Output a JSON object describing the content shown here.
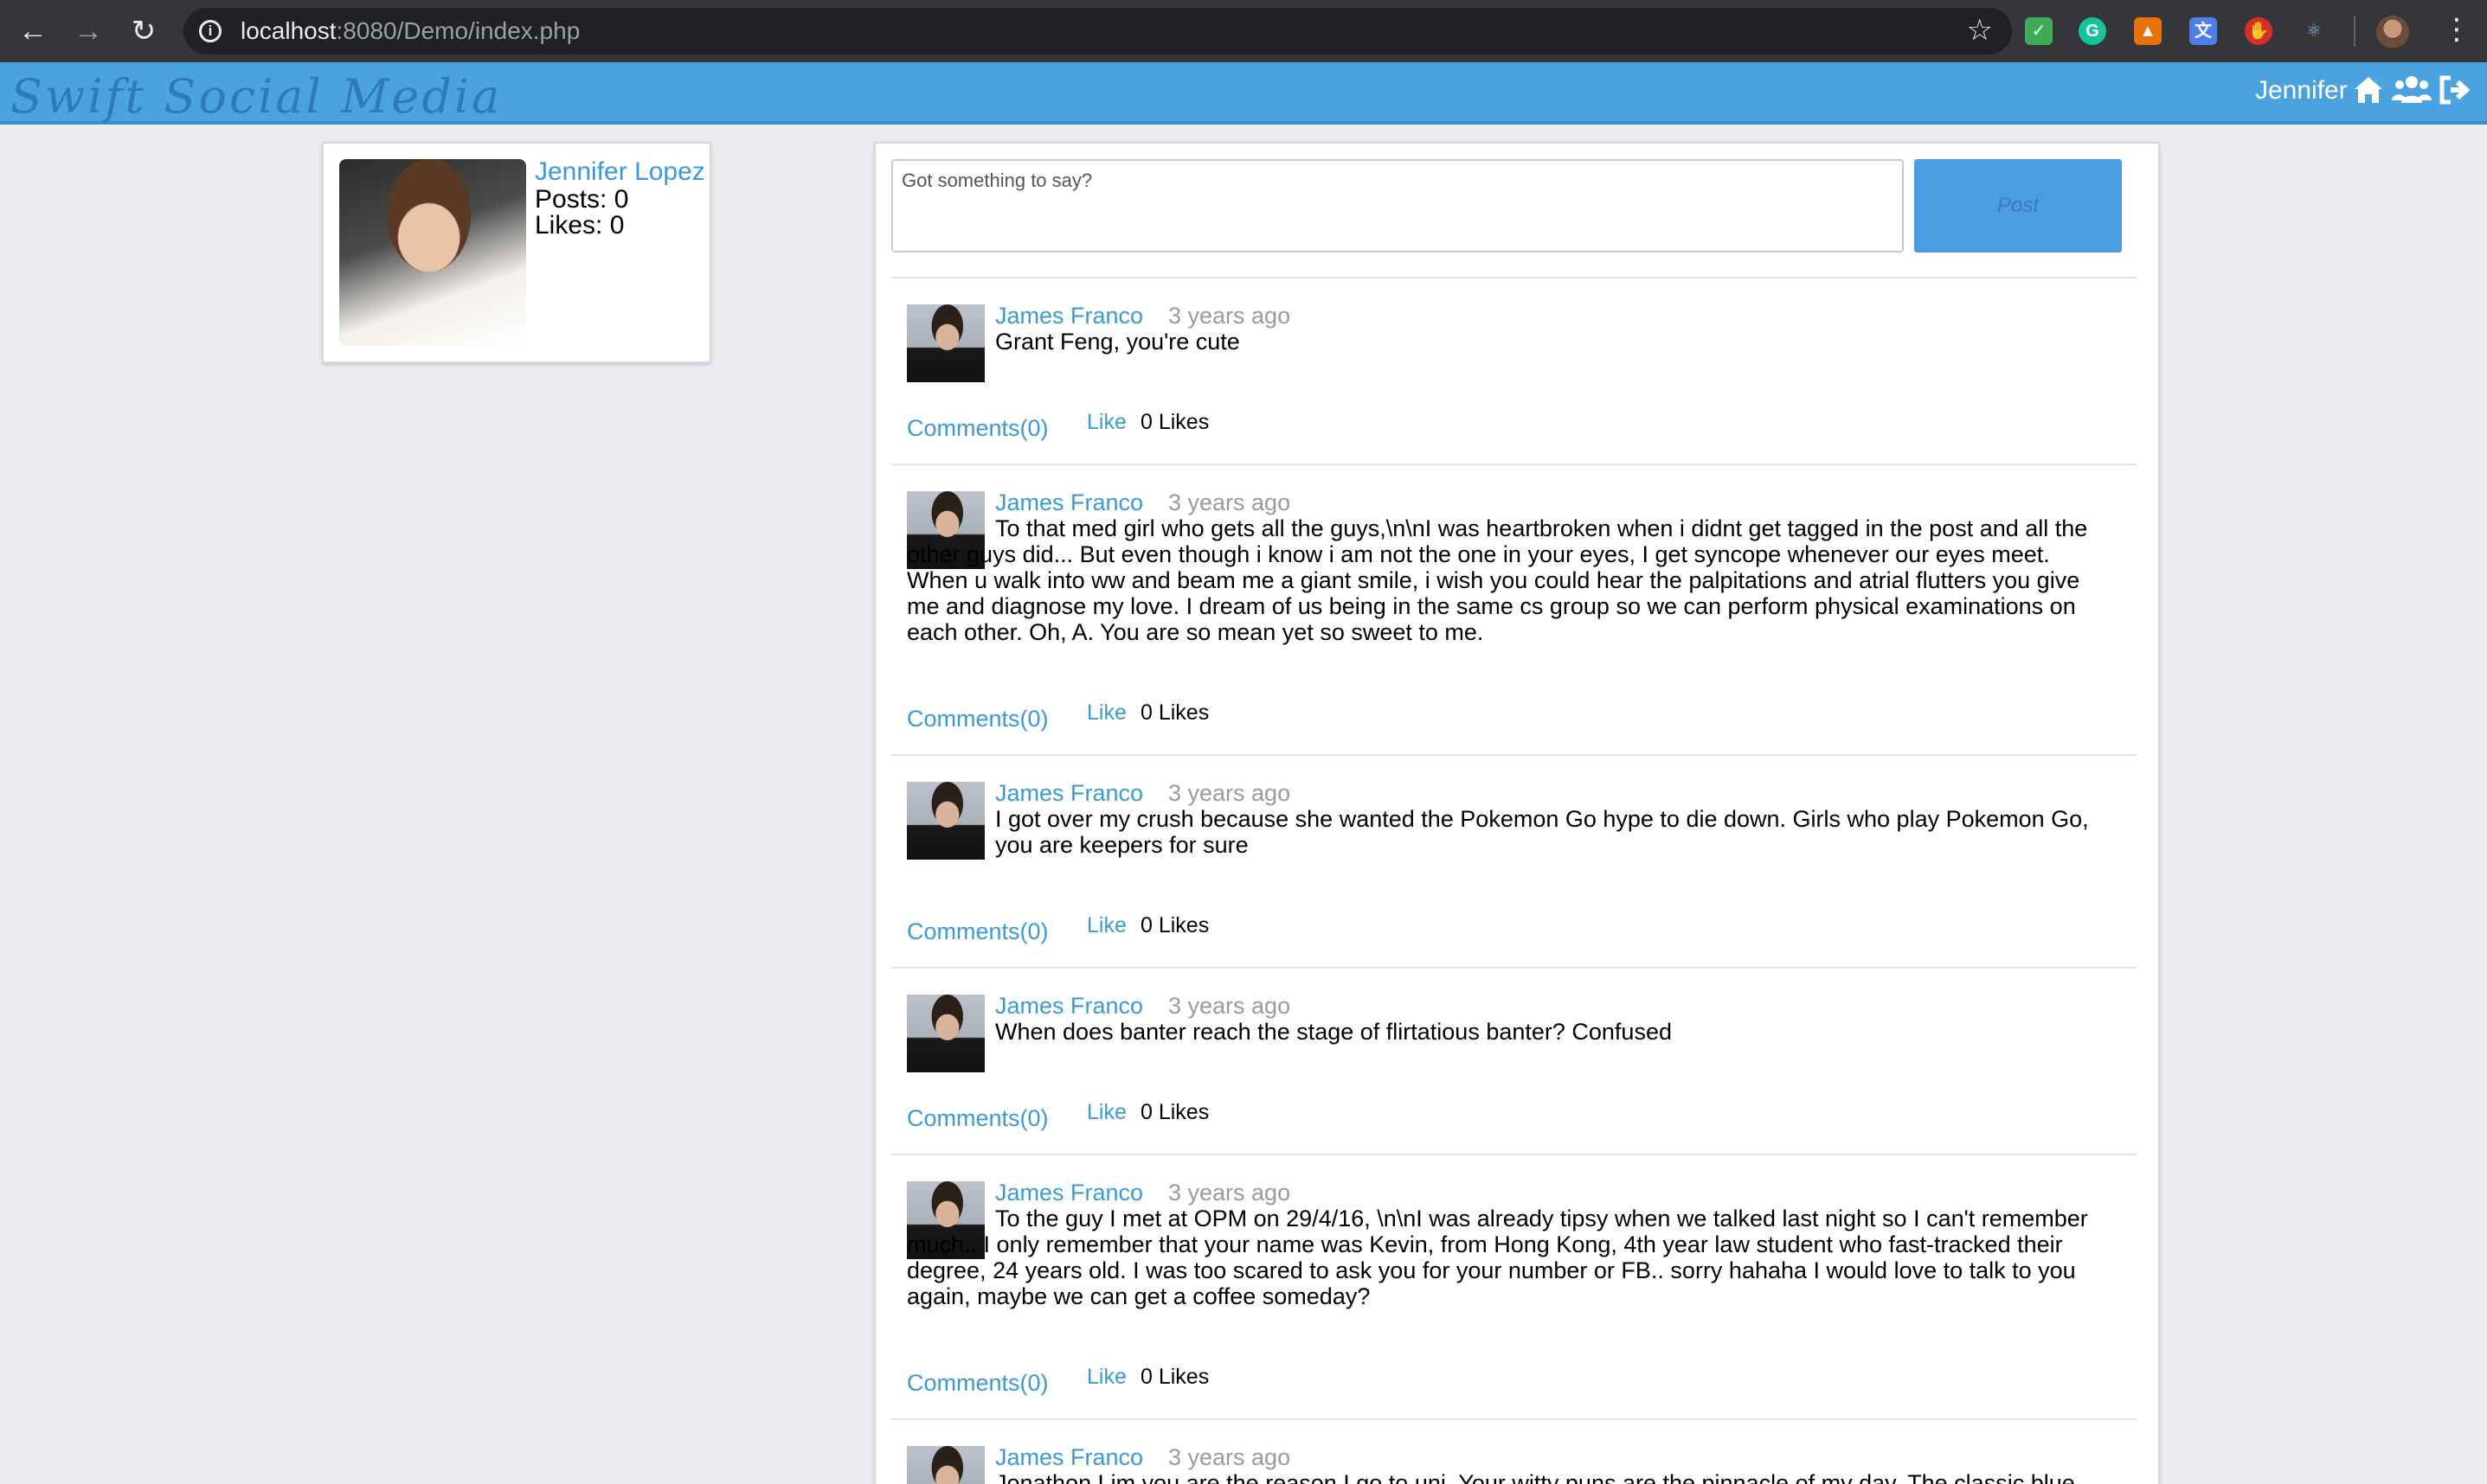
{
  "browser": {
    "url_host": "localhost",
    "url_path": ":8080/Demo/index.php",
    "extension_colors": [
      "#3dab5a",
      "#15c39a",
      "#e8710a",
      "#4f7ee8",
      "#d93025",
      "#4285f4"
    ]
  },
  "app": {
    "brand": "Swift Social Media",
    "header_user": "Jennifer"
  },
  "profile": {
    "name": "Jennifer Lopez",
    "posts": "Posts: 0",
    "likes": "Likes: 0"
  },
  "composer": {
    "placeholder": "Got something to say?",
    "post_label": "Post"
  },
  "posts": [
    {
      "author": "James Franco",
      "time": "3 years ago",
      "text": "Grant Feng, you're cute",
      "comments": "Comments(0)",
      "like": "Like",
      "likes": "0 Likes"
    },
    {
      "author": "James Franco",
      "time": "3 years ago",
      "text": "To that med girl who gets all the guys,\\n\\nI was heartbroken when i didnt get tagged in the post and all the other guys did... But even though i know i am not the one in your eyes, I get syncope whenever our eyes meet. When u walk into ww and beam me a giant smile, i wish you could hear the palpitations and atrial flutters you give me and diagnose my love. I dream of us being in the same cs group so we can perform physical examinations on each other. Oh, A. You are so mean yet so sweet to me.",
      "comments": "Comments(0)",
      "like": "Like",
      "likes": "0 Likes"
    },
    {
      "author": "James Franco",
      "time": "3 years ago",
      "text": "I got over my crush because she wanted the Pokemon Go hype to die down. Girls who play Pokemon Go, you are keepers for sure",
      "comments": "Comments(0)",
      "like": "Like",
      "likes": "0 Likes"
    },
    {
      "author": "James Franco",
      "time": "3 years ago",
      "text": "When does banter reach the stage of flirtatious banter? Confused",
      "comments": "Comments(0)",
      "like": "Like",
      "likes": "0 Likes"
    },
    {
      "author": "James Franco",
      "time": "3 years ago",
      "text": "To the guy I met at OPM on 29/4/16, \\n\\nI was already tipsy when we talked last night so I can't remember much.. I only remember that your name was Kevin, from Hong Kong, 4th year law student who fast-tracked their degree, 24 years old. I was too scared to ask you for your number or FB.. sorry hahaha I would love to talk to you again, maybe we can get a coffee someday?",
      "comments": "Comments(0)",
      "like": "Like",
      "likes": "0 Likes"
    },
    {
      "author": "James Franco",
      "time": "3 years ago",
      "text": "Jonathon Lim you are the reason I go to uni. Your witty puns are the pinnacle of my day. The classic blue",
      "comments": "",
      "like": "",
      "likes": ""
    }
  ]
}
